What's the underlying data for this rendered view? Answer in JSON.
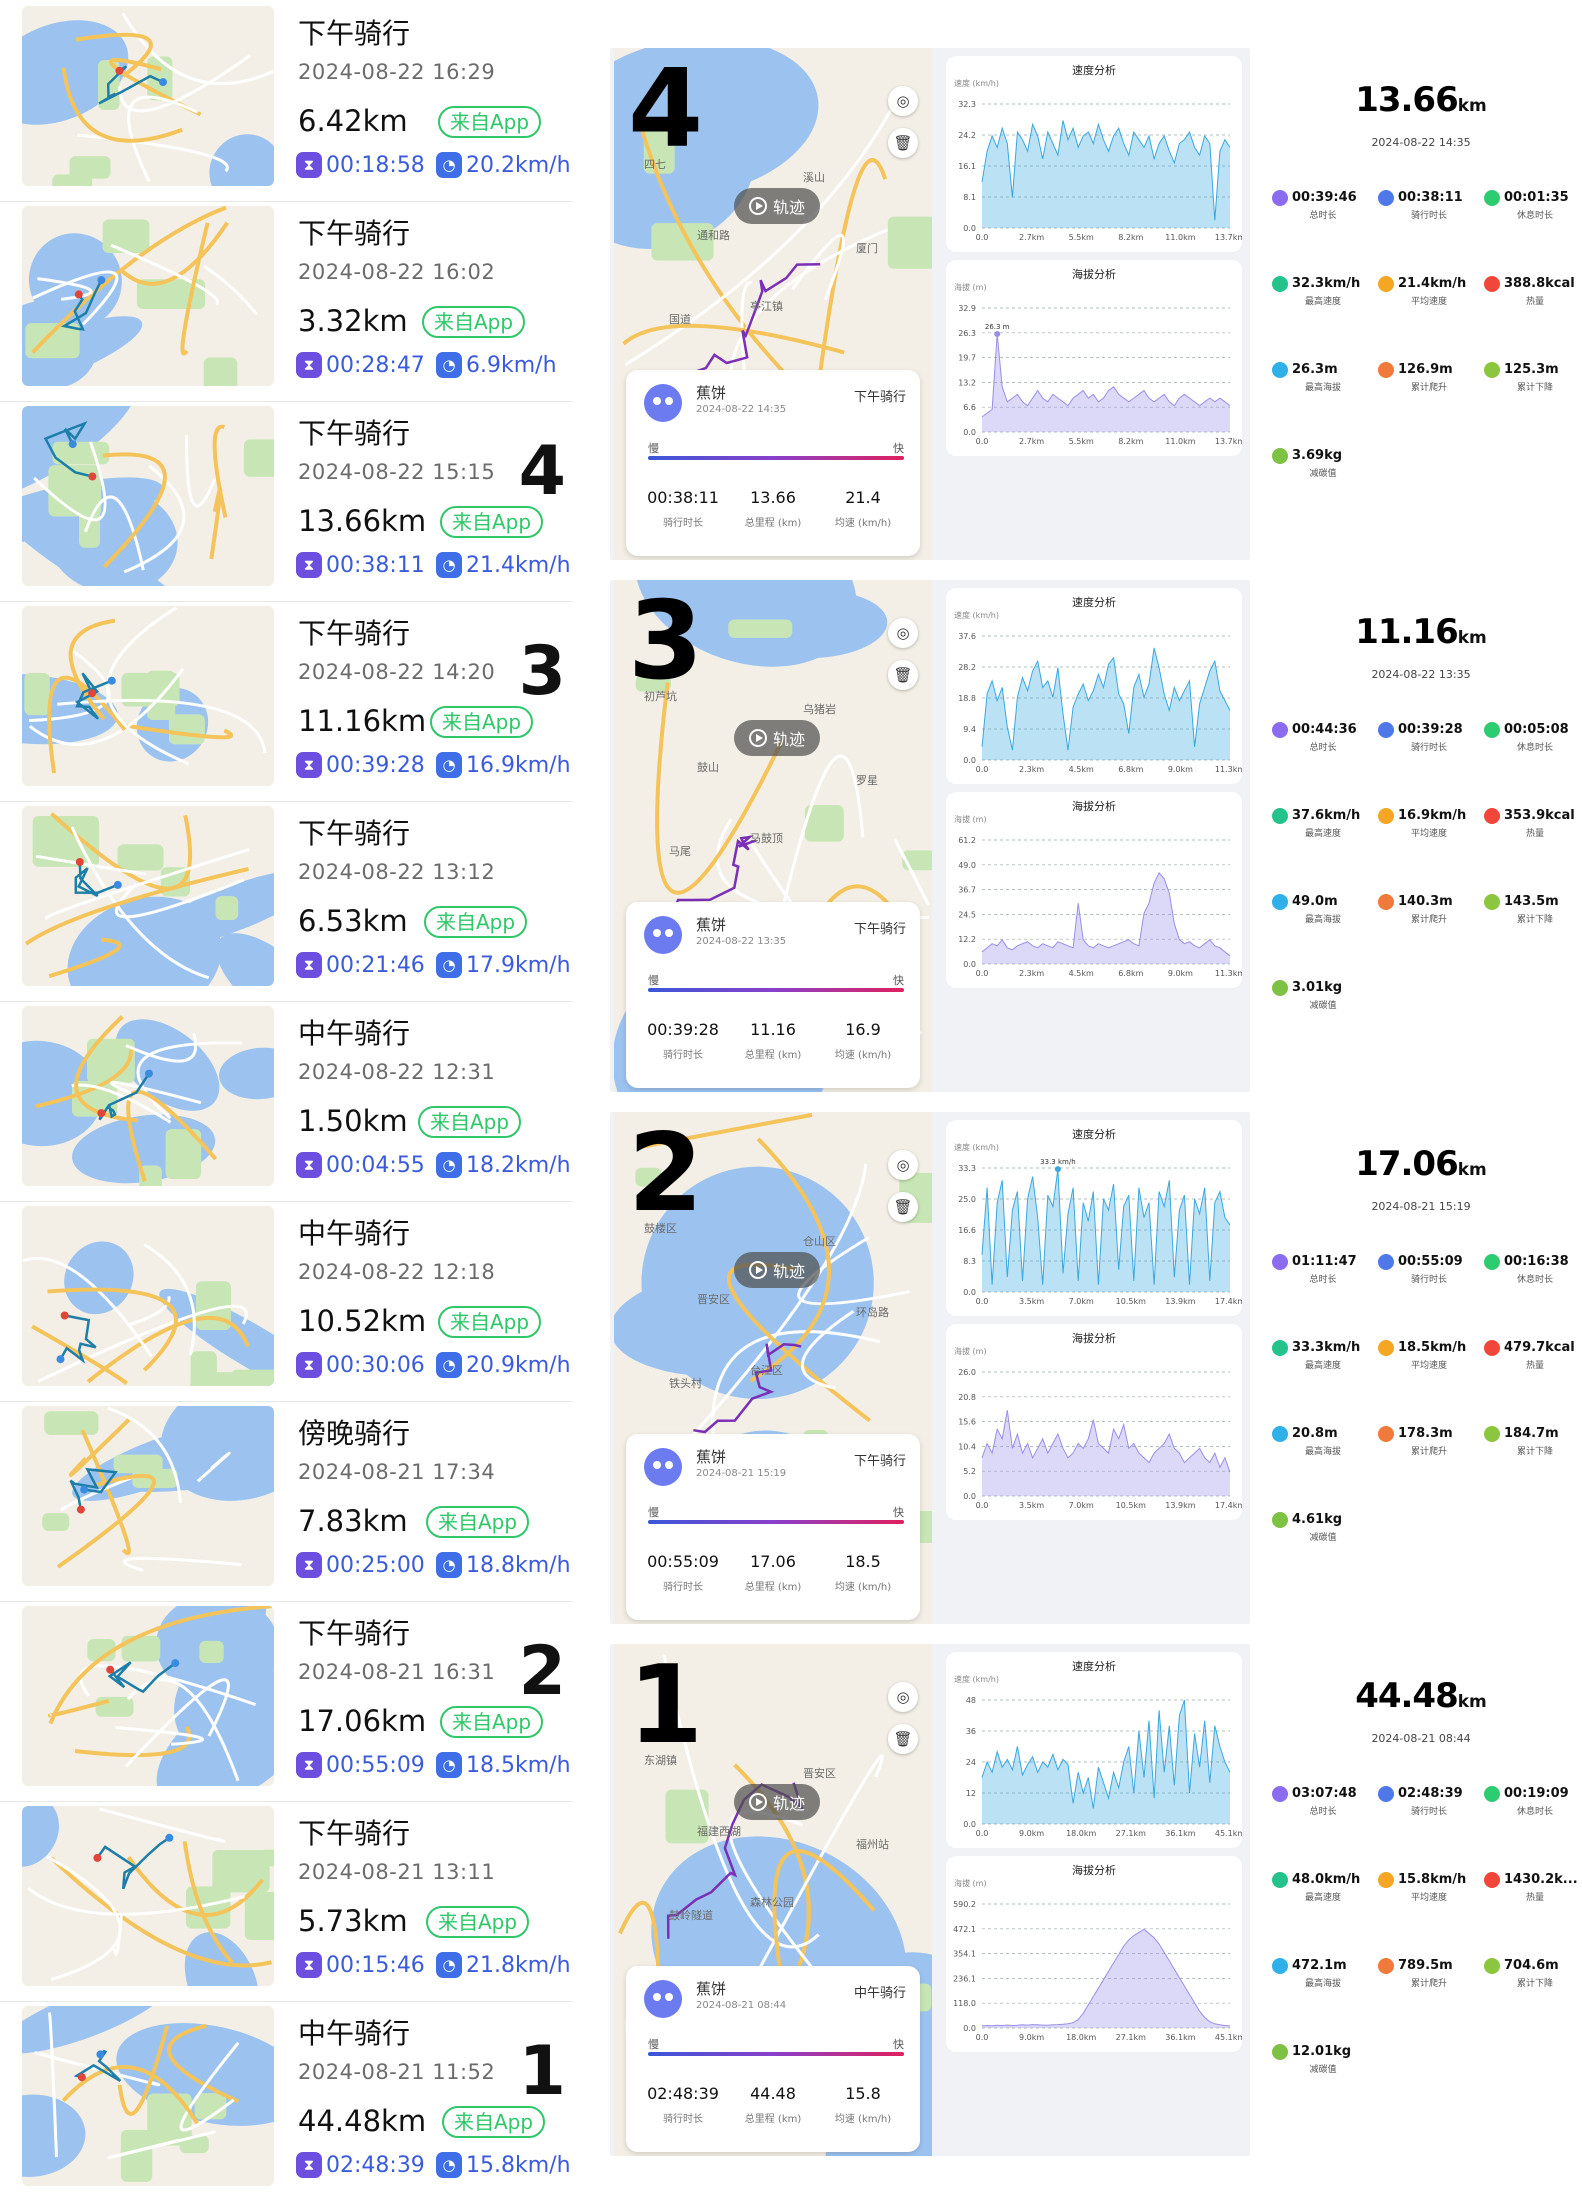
{
  "rides": [
    {
      "title": "下午骑行",
      "date": "2024-08-22 16:29",
      "distance": "6.42km",
      "badge": "来自App",
      "duration": "00:18:58",
      "speed": "20.2km/h",
      "marker": ""
    },
    {
      "title": "下午骑行",
      "date": "2024-08-22 16:02",
      "distance": "3.32km",
      "badge": "来自App",
      "duration": "00:28:47",
      "speed": "6.9km/h",
      "marker": ""
    },
    {
      "title": "下午骑行",
      "date": "2024-08-22 15:15",
      "distance": "13.66km",
      "badge": "来自App",
      "duration": "00:38:11",
      "speed": "21.4km/h",
      "marker": "4"
    },
    {
      "title": "下午骑行",
      "date": "2024-08-22 14:20",
      "distance": "11.16km",
      "badge": "来自App",
      "duration": "00:39:28",
      "speed": "16.9km/h",
      "marker": "3"
    },
    {
      "title": "下午骑行",
      "date": "2024-08-22 13:12",
      "distance": "6.53km",
      "badge": "来自App",
      "duration": "00:21:46",
      "speed": "17.9km/h",
      "marker": ""
    },
    {
      "title": "中午骑行",
      "date": "2024-08-22 12:31",
      "distance": "1.50km",
      "badge": "来自App",
      "duration": "00:04:55",
      "speed": "18.2km/h",
      "marker": ""
    },
    {
      "title": "中午骑行",
      "date": "2024-08-22 12:18",
      "distance": "10.52km",
      "badge": "来自App",
      "duration": "00:30:06",
      "speed": "20.9km/h",
      "marker": ""
    },
    {
      "title": "傍晚骑行",
      "date": "2024-08-21 17:34",
      "distance": "7.83km",
      "badge": "来自App",
      "duration": "00:25:00",
      "speed": "18.8km/h",
      "marker": ""
    },
    {
      "title": "下午骑行",
      "date": "2024-08-21 16:31",
      "distance": "17.06km",
      "badge": "来自App",
      "duration": "00:55:09",
      "speed": "18.5km/h",
      "marker": "2"
    },
    {
      "title": "下午骑行",
      "date": "2024-08-21 13:11",
      "distance": "5.73km",
      "badge": "来自App",
      "duration": "00:15:46",
      "speed": "21.8km/h",
      "marker": ""
    },
    {
      "title": "中午骑行",
      "date": "2024-08-21 11:52",
      "distance": "44.48km",
      "badge": "来自App",
      "duration": "02:48:39",
      "speed": "15.8km/h",
      "marker": "1"
    }
  ],
  "panels": [
    {
      "number": "4",
      "track_label": "轨迹",
      "user": "蕉饼",
      "card_date": "2024-08-22 14:35",
      "ride_type": "下午骑行",
      "slow": "慢",
      "fast": "快",
      "summary": [
        {
          "v": "00:38:11",
          "l": "骑行时长"
        },
        {
          "v": "13.66",
          "l": "总里程 (km)"
        },
        {
          "v": "21.4",
          "l": "均速 (km/h)"
        }
      ],
      "speed_chart": {
        "title": "速度分析",
        "ylabel": "速度 (km/h)",
        "yticks": [
          "32.3",
          "24.2",
          "16.1",
          "8.1",
          "0.0"
        ],
        "xticks": [
          "0.0",
          "2.7km",
          "5.5km",
          "8.2km",
          "11.0km",
          "13.7km"
        ],
        "peak": ""
      },
      "alt_chart": {
        "title": "海拔分析",
        "ylabel": "海拔 (m)",
        "yticks": [
          "32.9",
          "26.3",
          "19.7",
          "13.2",
          "6.6",
          "0.0"
        ],
        "xticks": [
          "0.0",
          "2.7km",
          "5.5km",
          "8.2km",
          "11.0km",
          "13.7km"
        ],
        "peak": "26.3 m"
      },
      "total": "13.66",
      "unit": "km",
      "date": "2024-08-22 14:35",
      "stats": [
        {
          "v": "00:39:46",
          "l": "总时长",
          "c": "#8b6cf0"
        },
        {
          "v": "00:38:11",
          "l": "骑行时长",
          "c": "#4f79e8"
        },
        {
          "v": "00:01:35",
          "l": "休息时长",
          "c": "#2ecc71"
        },
        {
          "v": "32.3km/h",
          "l": "最高速度",
          "c": "#25c38b"
        },
        {
          "v": "21.4km/h",
          "l": "平均速度",
          "c": "#f5a623"
        },
        {
          "v": "388.8kcal",
          "l": "热量",
          "c": "#f0473a"
        },
        {
          "v": "26.3m",
          "l": "最高海拔",
          "c": "#2fb0e8"
        },
        {
          "v": "126.9m",
          "l": "累计爬升",
          "c": "#f07a3a"
        },
        {
          "v": "125.3m",
          "l": "累计下降",
          "c": "#8cc63f"
        },
        {
          "v": "3.69kg",
          "l": "减碳值",
          "c": "#7dc242"
        }
      ],
      "speed_series": [
        12,
        20,
        24,
        21,
        26,
        22,
        8,
        25,
        23,
        20,
        27,
        24,
        18,
        25,
        22,
        19,
        28,
        23,
        26,
        21,
        24,
        25,
        22,
        27,
        23,
        20,
        24,
        26,
        22,
        19,
        25,
        23,
        21,
        24,
        18,
        22,
        24,
        20,
        17,
        22,
        23,
        25,
        21,
        19,
        24,
        22,
        2,
        20,
        23,
        21
      ],
      "alt_series": [
        4,
        5,
        6,
        26,
        12,
        8,
        9,
        10,
        8,
        7,
        9,
        11,
        9,
        8,
        10,
        9,
        8,
        7,
        9,
        10,
        11,
        9,
        10,
        8,
        9,
        11,
        12,
        10,
        9,
        8,
        9,
        10,
        11,
        9,
        8,
        9,
        10,
        8,
        7,
        9,
        10,
        9,
        8,
        7,
        8,
        9,
        8,
        9,
        8,
        7
      ]
    },
    {
      "number": "3",
      "track_label": "轨迹",
      "user": "蕉饼",
      "card_date": "2024-08-22 13:35",
      "ride_type": "下午骑行",
      "slow": "慢",
      "fast": "快",
      "summary": [
        {
          "v": "00:39:28",
          "l": "骑行时长"
        },
        {
          "v": "11.16",
          "l": "总里程 (km)"
        },
        {
          "v": "16.9",
          "l": "均速 (km/h)"
        }
      ],
      "speed_chart": {
        "title": "速度分析",
        "ylabel": "速度 (km/h)",
        "yticks": [
          "37.6",
          "28.2",
          "18.8",
          "9.4",
          "0.0"
        ],
        "xticks": [
          "0.0",
          "2.3km",
          "4.5km",
          "6.8km",
          "9.0km",
          "11.3km"
        ],
        "peak": ""
      },
      "alt_chart": {
        "title": "海拔分析",
        "ylabel": "海拔 (m)",
        "yticks": [
          "61.2",
          "49.0",
          "36.7",
          "24.5",
          "12.2",
          "0.0"
        ],
        "xticks": [
          "0.0",
          "2.3km",
          "4.5km",
          "6.8km",
          "9.0km",
          "11.3km"
        ],
        "peak": ""
      },
      "total": "11.16",
      "unit": "km",
      "date": "2024-08-22 13:35",
      "stats": [
        {
          "v": "00:44:36",
          "l": "总时长",
          "c": "#8b6cf0"
        },
        {
          "v": "00:39:28",
          "l": "骑行时长",
          "c": "#4f79e8"
        },
        {
          "v": "00:05:08",
          "l": "休息时长",
          "c": "#2ecc71"
        },
        {
          "v": "37.6km/h",
          "l": "最高速度",
          "c": "#25c38b"
        },
        {
          "v": "16.9km/h",
          "l": "平均速度",
          "c": "#f5a623"
        },
        {
          "v": "353.9kcal",
          "l": "热量",
          "c": "#f0473a"
        },
        {
          "v": "49.0m",
          "l": "最高海拔",
          "c": "#2fb0e8"
        },
        {
          "v": "140.3m",
          "l": "累计爬升",
          "c": "#f07a3a"
        },
        {
          "v": "143.5m",
          "l": "累计下降",
          "c": "#8cc63f"
        },
        {
          "v": "3.01kg",
          "l": "减碳值",
          "c": "#7dc242"
        }
      ],
      "speed_series": [
        4,
        20,
        24,
        18,
        22,
        10,
        3,
        19,
        25,
        21,
        27,
        30,
        22,
        24,
        19,
        28,
        14,
        3,
        16,
        20,
        23,
        18,
        21,
        26,
        22,
        29,
        31,
        20,
        17,
        8,
        22,
        26,
        19,
        23,
        34,
        28,
        20,
        15,
        22,
        18,
        21,
        24,
        4,
        17,
        22,
        27,
        30,
        21,
        18,
        15
      ],
      "alt_series": [
        6,
        8,
        10,
        9,
        12,
        8,
        7,
        9,
        10,
        11,
        9,
        8,
        10,
        9,
        8,
        11,
        10,
        9,
        8,
        30,
        12,
        9,
        8,
        10,
        9,
        8,
        9,
        10,
        11,
        12,
        10,
        9,
        25,
        30,
        40,
        45,
        42,
        35,
        20,
        12,
        10,
        11,
        9,
        8,
        10,
        12,
        9,
        8,
        6,
        4
      ]
    },
    {
      "number": "2",
      "track_label": "轨迹",
      "user": "蕉饼",
      "card_date": "2024-08-21 15:19",
      "ride_type": "下午骑行",
      "slow": "慢",
      "fast": "快",
      "summary": [
        {
          "v": "00:55:09",
          "l": "骑行时长"
        },
        {
          "v": "17.06",
          "l": "总里程 (km)"
        },
        {
          "v": "18.5",
          "l": "均速 (km/h)"
        }
      ],
      "speed_chart": {
        "title": "速度分析",
        "ylabel": "速度 (km/h)",
        "yticks": [
          "33.3",
          "25.0",
          "16.6",
          "8.3",
          "0.0"
        ],
        "xticks": [
          "0.0",
          "3.5km",
          "7.0km",
          "10.5km",
          "13.9km",
          "17.4km"
        ],
        "peak": "33.3 km/h"
      },
      "alt_chart": {
        "title": "海拔分析",
        "ylabel": "海拔 (m)",
        "yticks": [
          "26.0",
          "20.8",
          "15.6",
          "10.4",
          "5.2",
          "0.0"
        ],
        "xticks": [
          "0.0",
          "3.5km",
          "7.0km",
          "10.5km",
          "13.9km",
          "17.4km"
        ],
        "peak": ""
      },
      "total": "17.06",
      "unit": "km",
      "date": "2024-08-21 15:19",
      "stats": [
        {
          "v": "01:11:47",
          "l": "总时长",
          "c": "#8b6cf0"
        },
        {
          "v": "00:55:09",
          "l": "骑行时长",
          "c": "#4f79e8"
        },
        {
          "v": "00:16:38",
          "l": "休息时长",
          "c": "#2ecc71"
        },
        {
          "v": "33.3km/h",
          "l": "最高速度",
          "c": "#25c38b"
        },
        {
          "v": "18.5km/h",
          "l": "平均速度",
          "c": "#f5a623"
        },
        {
          "v": "479.7kcal",
          "l": "热量",
          "c": "#f0473a"
        },
        {
          "v": "20.8m",
          "l": "最高海拔",
          "c": "#2fb0e8"
        },
        {
          "v": "178.3m",
          "l": "累计爬升",
          "c": "#f07a3a"
        },
        {
          "v": "184.7m",
          "l": "累计下降",
          "c": "#8cc63f"
        },
        {
          "v": "4.61kg",
          "l": "减碳值",
          "c": "#7dc242"
        }
      ],
      "speed_series": [
        10,
        28,
        2,
        24,
        30,
        4,
        22,
        27,
        3,
        25,
        31,
        20,
        2,
        26,
        23,
        33,
        5,
        21,
        28,
        3,
        24,
        19,
        27,
        2,
        25,
        22,
        29,
        6,
        23,
        26,
        3,
        28,
        20,
        24,
        2,
        27,
        23,
        30,
        4,
        22,
        26,
        2,
        25,
        21,
        28,
        3,
        24,
        27,
        20,
        18
      ],
      "alt_series": [
        8,
        11,
        9,
        14,
        12,
        18,
        10,
        13,
        9,
        11,
        8,
        10,
        12,
        9,
        11,
        13,
        10,
        8,
        9,
        11,
        10,
        12,
        16,
        11,
        10,
        9,
        14,
        12,
        15,
        10,
        11,
        9,
        8,
        7,
        9,
        10,
        11,
        13,
        10,
        9,
        7,
        8,
        9,
        10,
        8,
        7,
        9,
        6,
        8,
        5
      ]
    },
    {
      "number": "1",
      "track_label": "轨迹",
      "user": "蕉饼",
      "card_date": "2024-08-21 08:44",
      "ride_type": "中午骑行",
      "slow": "慢",
      "fast": "快",
      "summary": [
        {
          "v": "02:48:39",
          "l": "骑行时长"
        },
        {
          "v": "44.48",
          "l": "总里程 (km)"
        },
        {
          "v": "15.8",
          "l": "均速 (km/h)"
        }
      ],
      "speed_chart": {
        "title": "速度分析",
        "ylabel": "速度 (km/h)",
        "yticks": [
          "48",
          "36",
          "24",
          "12",
          "0.0"
        ],
        "xticks": [
          "0.0",
          "9.0km",
          "18.0km",
          "27.1km",
          "36.1km",
          "45.1km"
        ],
        "peak": ""
      },
      "alt_chart": {
        "title": "海拔分析",
        "ylabel": "海拔 (m)",
        "yticks": [
          "590.2",
          "472.1",
          "354.1",
          "236.1",
          "118.0",
          "0.0"
        ],
        "xticks": [
          "0.0",
          "9.0km",
          "18.0km",
          "27.1km",
          "36.1km",
          "45.1km"
        ],
        "peak": ""
      },
      "total": "44.48",
      "unit": "km",
      "date": "2024-08-21 08:44",
      "stats": [
        {
          "v": "03:07:48",
          "l": "总时长",
          "c": "#8b6cf0"
        },
        {
          "v": "02:48:39",
          "l": "骑行时长",
          "c": "#4f79e8"
        },
        {
          "v": "00:19:09",
          "l": "休息时长",
          "c": "#2ecc71"
        },
        {
          "v": "48.0km/h",
          "l": "最高速度",
          "c": "#25c38b"
        },
        {
          "v": "15.8km/h",
          "l": "平均速度",
          "c": "#f5a623"
        },
        {
          "v": "1430.2k...",
          "l": "热量",
          "c": "#f0473a"
        },
        {
          "v": "472.1m",
          "l": "最高海拔",
          "c": "#2fb0e8"
        },
        {
          "v": "789.5m",
          "l": "累计爬升",
          "c": "#f07a3a"
        },
        {
          "v": "704.6m",
          "l": "累计下降",
          "c": "#8cc63f"
        },
        {
          "v": "12.01kg",
          "l": "减碳值",
          "c": "#7dc242"
        }
      ],
      "speed_series": [
        18,
        24,
        20,
        28,
        22,
        25,
        21,
        30,
        19,
        23,
        26,
        20,
        24,
        22,
        27,
        21,
        25,
        23,
        8,
        20,
        12,
        18,
        6,
        22,
        16,
        10,
        20,
        14,
        24,
        30,
        12,
        36,
        18,
        40,
        10,
        44,
        20,
        38,
        15,
        42,
        48,
        12,
        35,
        22,
        40,
        16,
        38,
        30,
        24,
        20
      ],
      "alt_series": [
        10,
        12,
        11,
        13,
        12,
        14,
        12,
        13,
        15,
        14,
        16,
        15,
        14,
        13,
        15,
        16,
        18,
        20,
        25,
        40,
        70,
        110,
        150,
        190,
        230,
        270,
        310,
        350,
        390,
        420,
        440,
        455,
        470,
        450,
        430,
        400,
        360,
        320,
        280,
        240,
        200,
        160,
        120,
        80,
        50,
        30,
        20,
        15,
        12,
        10
      ]
    }
  ],
  "map_labels": [
    [
      "四七",
      "通和路",
      "亭江镇",
      "溪山",
      "厦门",
      "国道"
    ],
    [
      "初芦坑",
      "鼓山",
      "马鼓顶",
      "乌猪岩",
      "罗星",
      "马尾"
    ],
    [
      "鼓楼区",
      "晋安区",
      "台江区",
      "仓山区",
      "环岛路",
      "铁头村"
    ],
    [
      "东湖镇",
      "福建西湖",
      "森林公园",
      "晋安区",
      "福州站",
      "鼓岭隧道"
    ]
  ],
  "colors": {
    "accent": "#3b5bdb",
    "badge": "#2fc76a",
    "speed": "#3aa8df",
    "alt": "#9a8ee8",
    "track": "#7b2fb6"
  }
}
